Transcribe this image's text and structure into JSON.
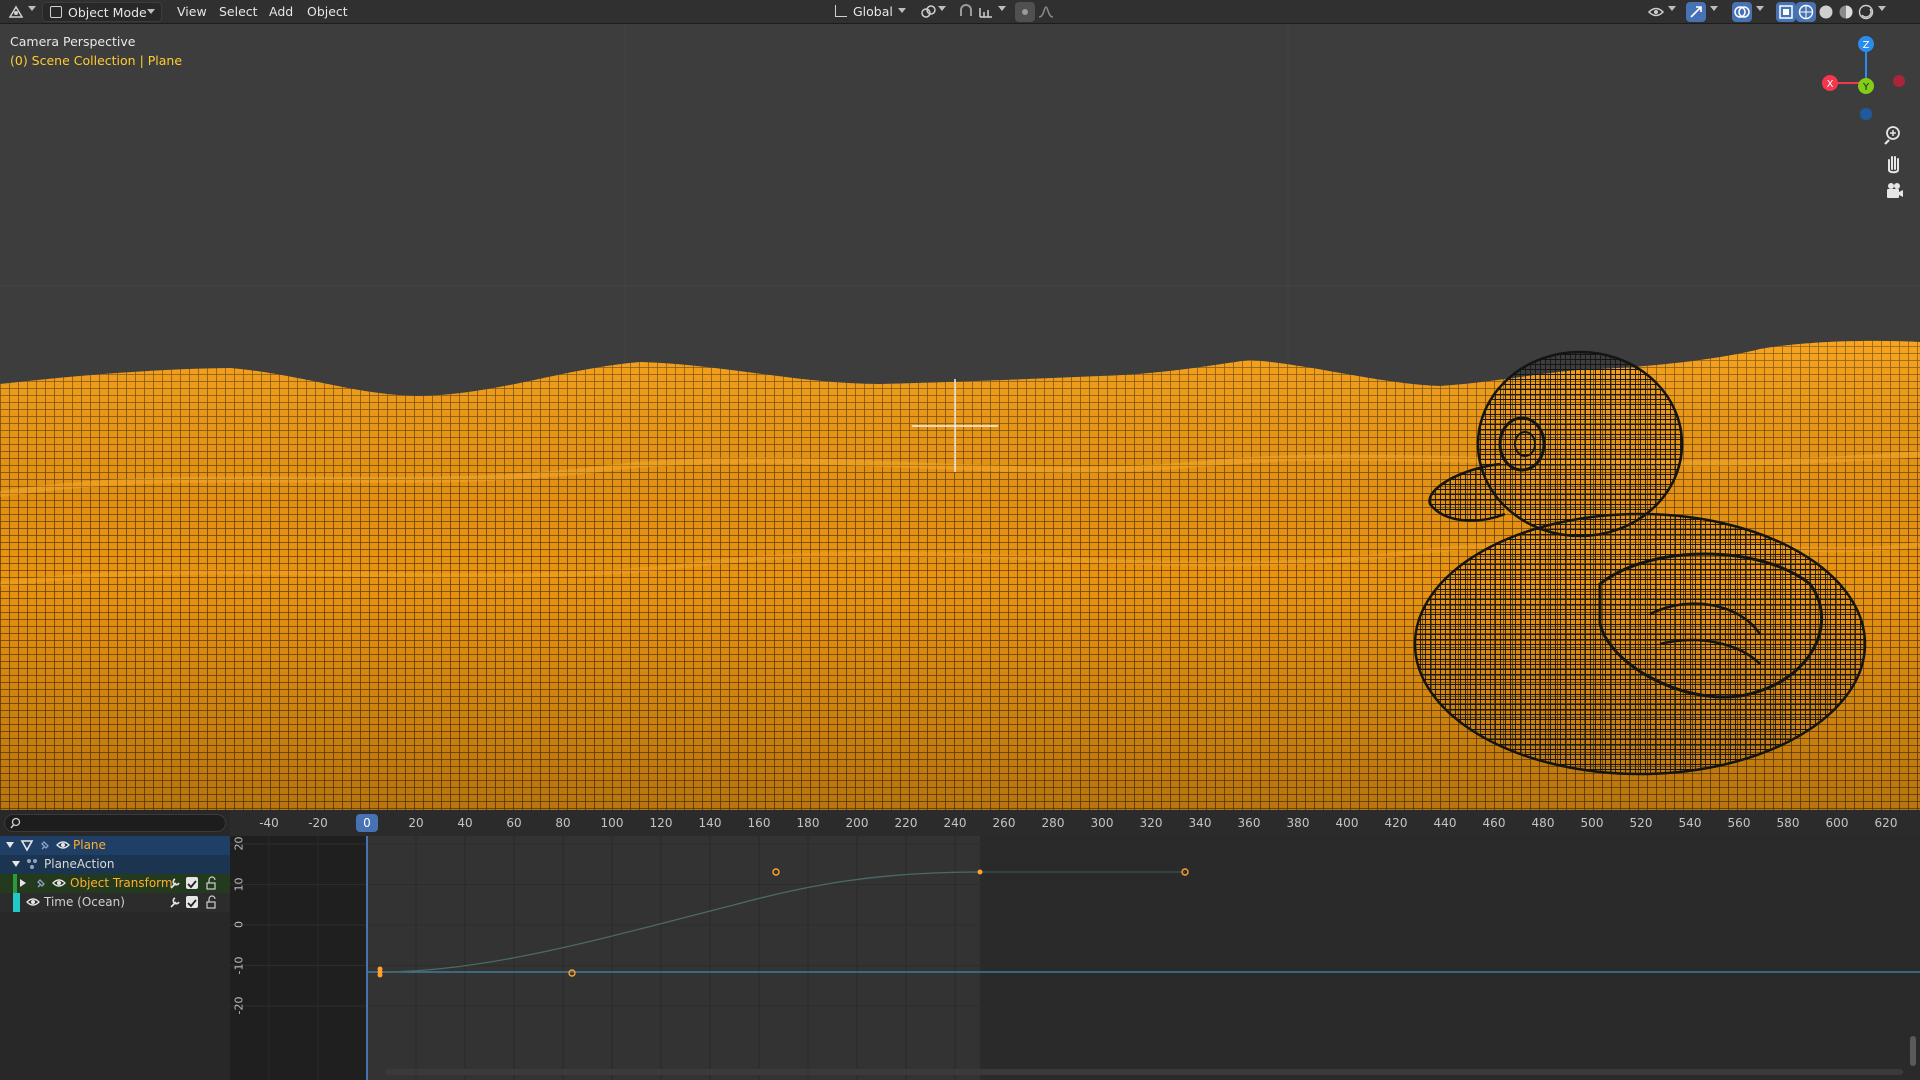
{
  "header": {
    "mode_label": "Object Mode",
    "menu": [
      "View",
      "Select",
      "Add",
      "Object"
    ],
    "transform_orientation": "Global"
  },
  "viewport": {
    "title": "Camera Perspective",
    "collection_label": "(0) Scene Collection | Plane",
    "gizmo_axes": {
      "x": "X",
      "y": "Y",
      "z": "Z"
    },
    "colors": {
      "background": "#3d3d3d",
      "wire_selected": "#ff9a12",
      "wire_object": "#1a1a1a",
      "axis_x": "#f5364e",
      "axis_y": "#83cc17",
      "axis_z": "#2b8cf0"
    }
  },
  "channels": {
    "search_placeholder": "",
    "items": [
      {
        "label": "Plane"
      },
      {
        "label": "PlaneAction"
      },
      {
        "label": "Object Transform"
      },
      {
        "label": "Time (Ocean)"
      }
    ]
  },
  "timeline": {
    "ruler_ticks": [
      "-40",
      "-20",
      "0",
      "20",
      "40",
      "60",
      "80",
      "100",
      "120",
      "140",
      "160",
      "180",
      "200",
      "220",
      "240",
      "260",
      "280",
      "300",
      "320",
      "340",
      "360",
      "380",
      "400",
      "420",
      "440",
      "460",
      "480",
      "500",
      "520",
      "540",
      "560",
      "580",
      "600",
      "620"
    ],
    "current_frame": "0",
    "y_ticks": [
      "20",
      "10",
      "0",
      "-10",
      "-20"
    ]
  }
}
